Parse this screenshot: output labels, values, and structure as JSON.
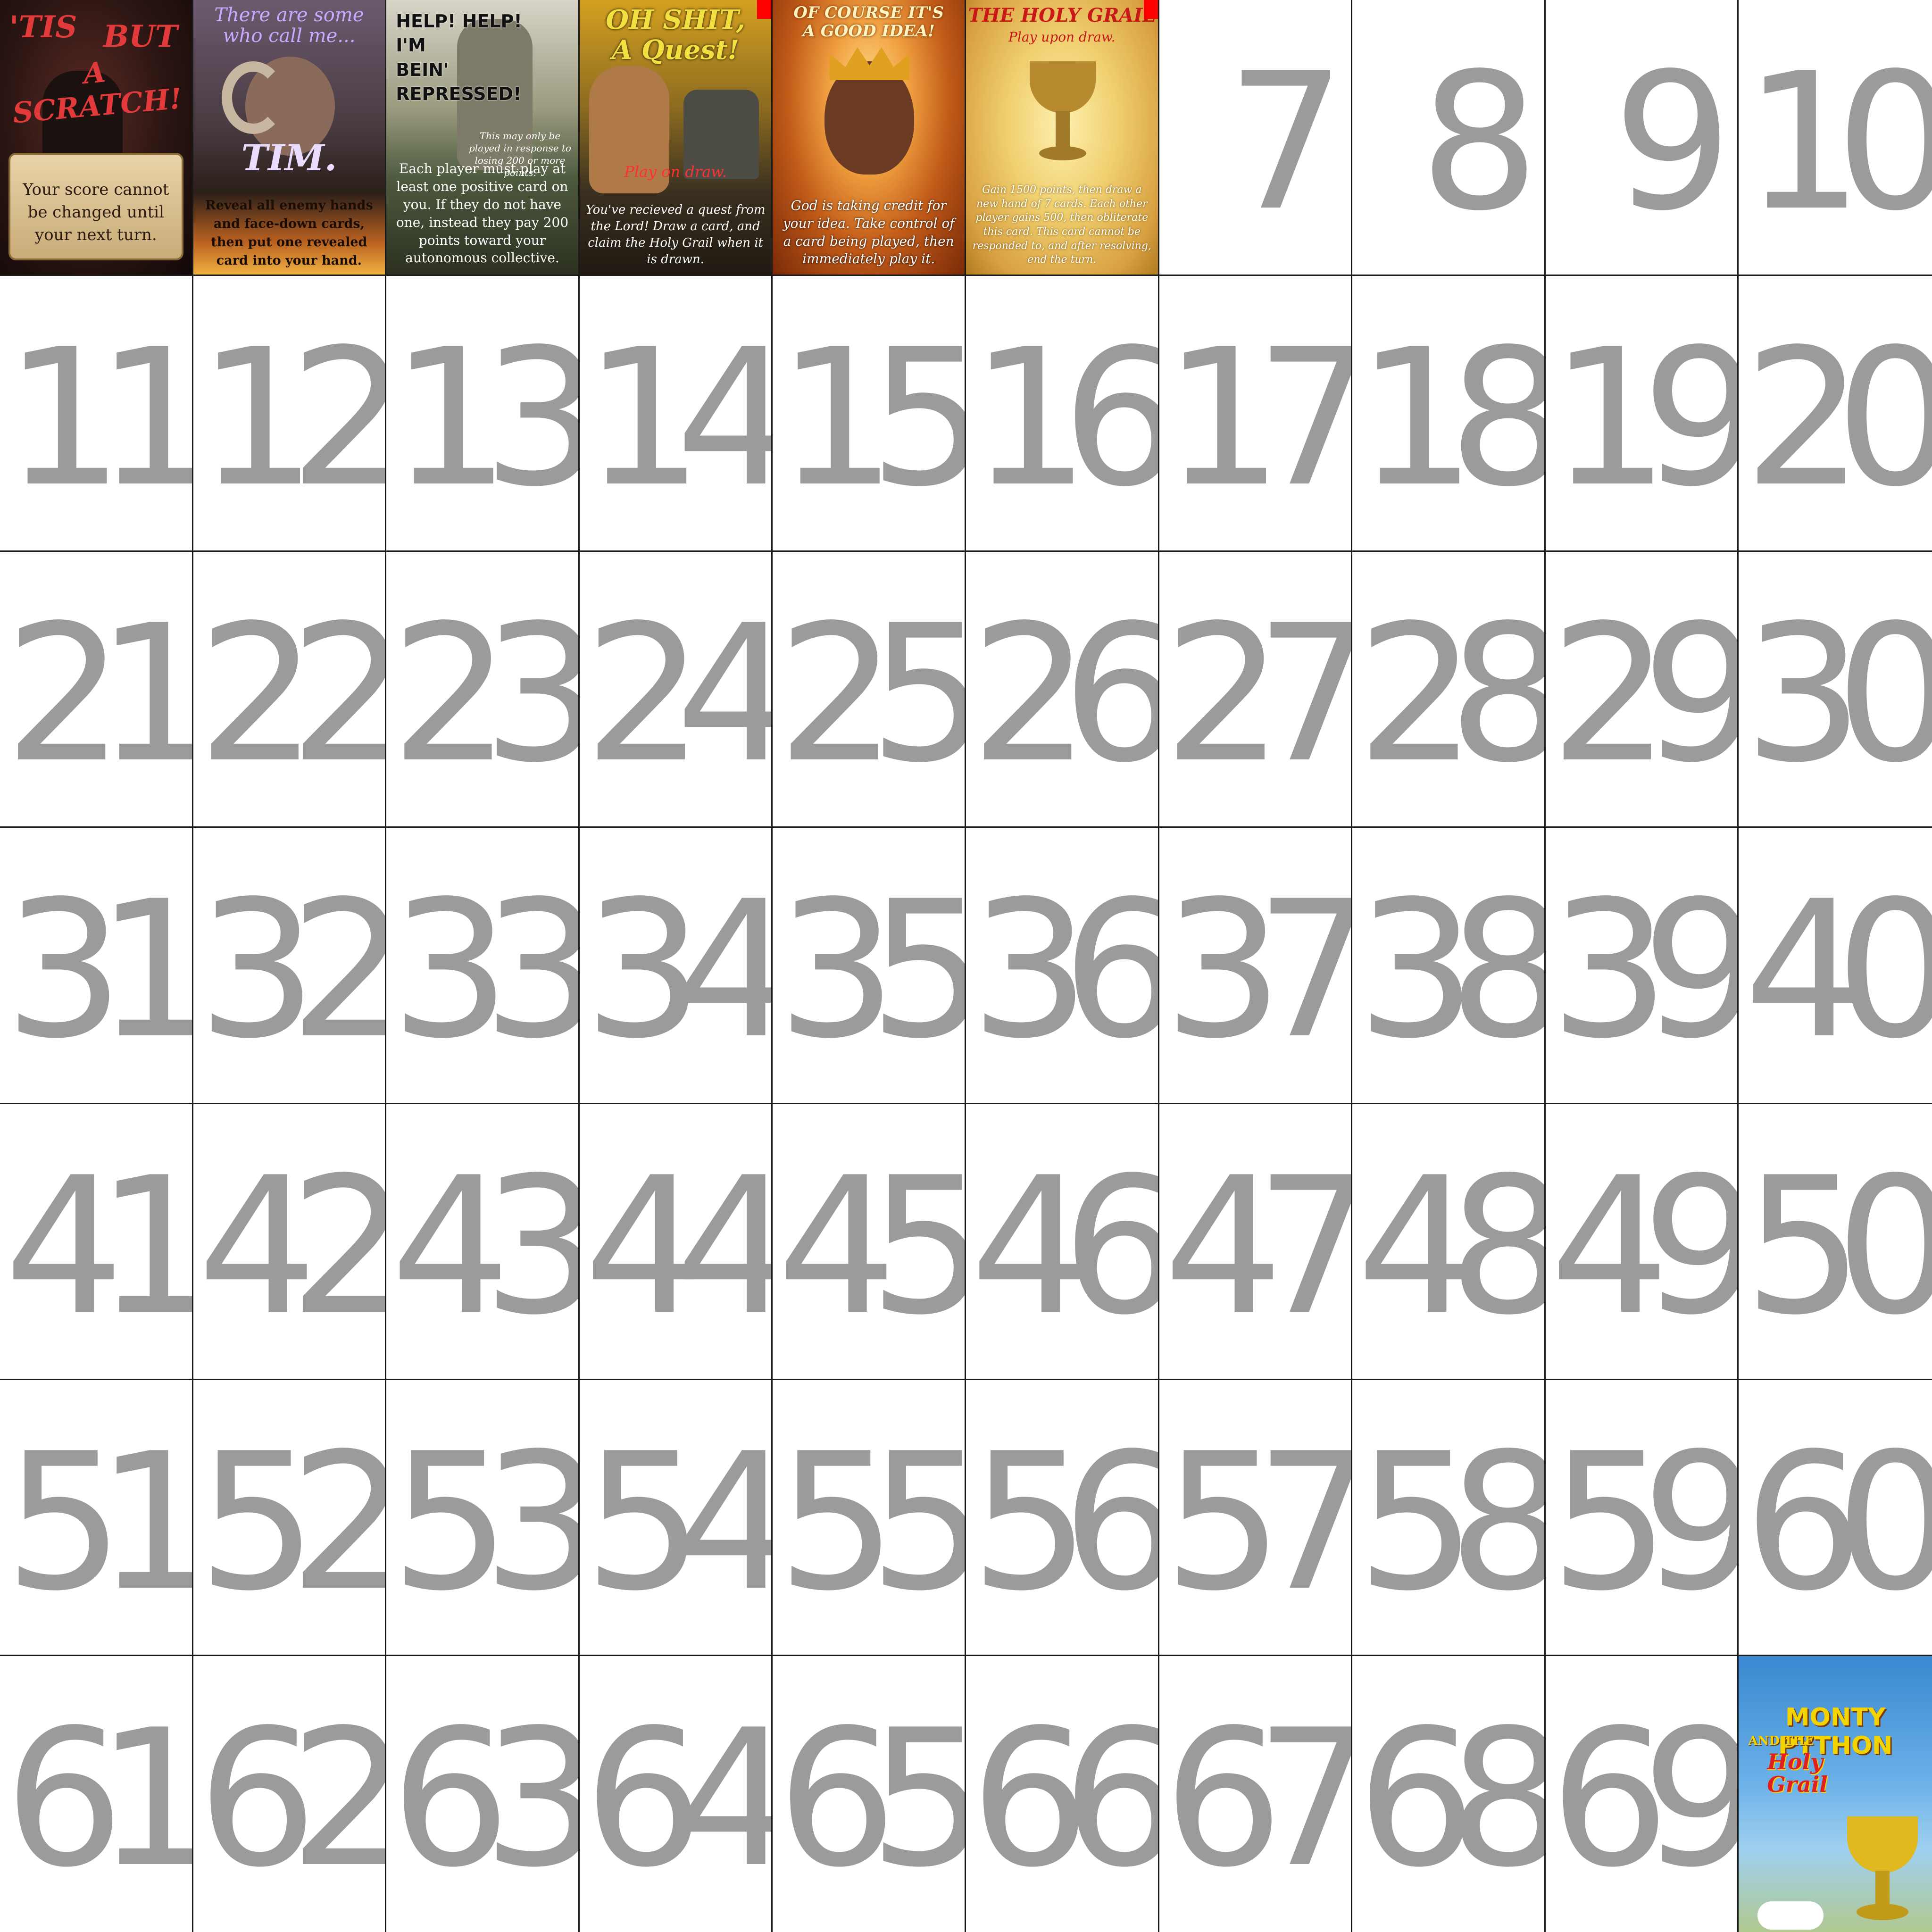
{
  "grid": {
    "columns": 10,
    "rows": 7
  },
  "cards": {
    "card1": {
      "title_parts": [
        "'TIS",
        "BUT",
        "A SCRATCH!"
      ],
      "body": "Your score cannot be changed until your next turn."
    },
    "card2": {
      "title": "There are some who call me...",
      "name": "TIM.",
      "body": "Reveal all enemy hands and face-down cards, then put one revealed card into your hand."
    },
    "card3": {
      "title_lines": [
        "HELP! HELP!",
        "I'M",
        "BEIN'",
        "REPRESSED!"
      ],
      "small": "This may only be played in response to losing 200 or more points.",
      "body": "Each player must play at least one positive card on you. If they do not have one, instead they pay 200 points toward your autonomous collective."
    },
    "card4": {
      "title_lines": [
        "OH SHIT,",
        "A Quest!"
      ],
      "play": "Play on draw.",
      "body": "You've recieved a quest from the Lord! Draw a card, and claim the Holy Grail when it is drawn."
    },
    "card5": {
      "title_lines": [
        "OF COURSE IT'S",
        "A GOOD IDEA!"
      ],
      "body": "God is taking credit for your idea. Take control of a card being played, then immediately play it."
    },
    "card6": {
      "title": "THE HOLY GRAIL",
      "play": "Play upon draw.",
      "body": "Gain 1500 points, then draw a new hand of 7 cards. Each other player gains 500, then obliterate this card. This card cannot be responded to, and after resolving, end the turn."
    },
    "card70": {
      "title1": "MONTY PYTHON",
      "title2": "AND THE",
      "title3_lines": [
        "Holy",
        "Grail"
      ]
    }
  },
  "slot_numbers": [
    "7",
    "8",
    "9",
    "10",
    "11",
    "12",
    "13",
    "14",
    "15",
    "16",
    "17",
    "18",
    "19",
    "20",
    "21",
    "22",
    "23",
    "24",
    "25",
    "26",
    "27",
    "28",
    "29",
    "30",
    "31",
    "32",
    "33",
    "34",
    "35",
    "36",
    "37",
    "38",
    "39",
    "40",
    "41",
    "42",
    "43",
    "44",
    "45",
    "46",
    "47",
    "48",
    "49",
    "50",
    "51",
    "52",
    "53",
    "54",
    "55",
    "56",
    "57",
    "58",
    "59",
    "60",
    "61",
    "62",
    "63",
    "64",
    "65",
    "66",
    "67",
    "68",
    "69"
  ],
  "colors": {
    "number_gray": "#9b9b9b",
    "grid_line": "#1a1a1a",
    "marker_red": "#ff0000"
  }
}
